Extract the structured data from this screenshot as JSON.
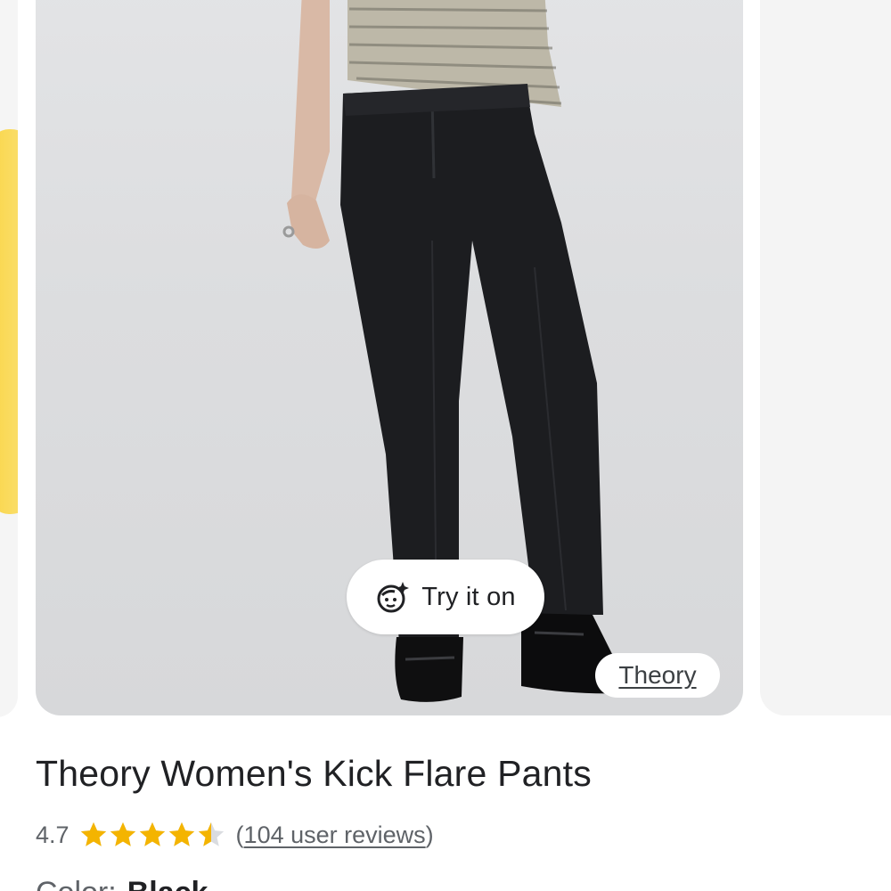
{
  "carousel": {
    "try_on_label": "Try it on",
    "brand_label": "Theory"
  },
  "product": {
    "title": "Theory Women's Kick Flare Pants",
    "rating_value": "4.7",
    "rating_stars": 4.7,
    "reviews_open": "(",
    "reviews_label": "104 user reviews",
    "reviews_close": ")",
    "color_label": "Color:",
    "color_value": "Black"
  },
  "icons": {
    "try_on": "face-sparkle-icon",
    "star": "star-icon"
  },
  "colors": {
    "star_fill": "#f4b400",
    "star_empty": "#dadce0",
    "text_primary": "#202124",
    "text_secondary": "#5f6368"
  }
}
